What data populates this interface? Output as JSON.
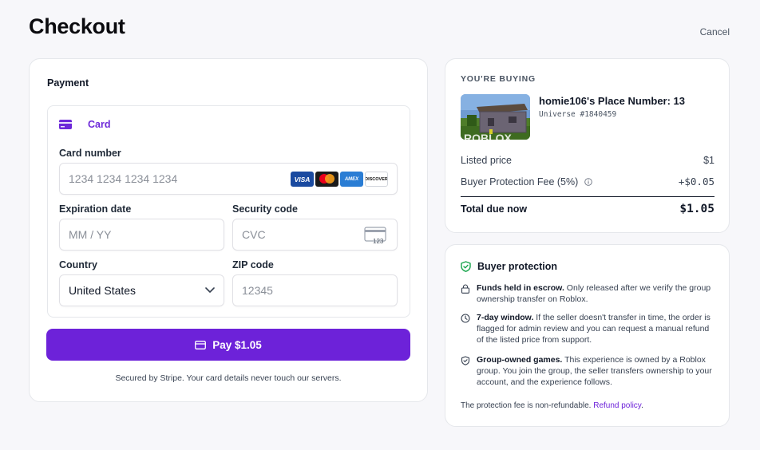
{
  "header": {
    "title": "Checkout",
    "cancel_label": "Cancel"
  },
  "payment": {
    "heading": "Payment",
    "method_tab": "Card",
    "card_number": {
      "label": "Card number",
      "placeholder": "1234 1234 1234 1234",
      "value": ""
    },
    "card_brands": [
      "VISA",
      "Mastercard",
      "AMEX",
      "DISCOVER"
    ],
    "expiration": {
      "label": "Expiration date",
      "placeholder": "MM / YY",
      "value": ""
    },
    "security_code": {
      "label": "Security code",
      "placeholder": "CVC",
      "value": "",
      "icon_text": "123"
    },
    "country": {
      "label": "Country",
      "value": "United States"
    },
    "zip": {
      "label": "ZIP code",
      "placeholder": "12345",
      "value": ""
    },
    "pay_button_label": "Pay $1.05",
    "secure_note": "Secured by Stripe. Your card details never touch our servers."
  },
  "summary": {
    "eyebrow": "YOU'RE BUYING",
    "product_name": "homie106's Place Number: 13",
    "universe": "Universe #1840459",
    "thumb_text": "ROBLOX",
    "rows": [
      {
        "label": "Listed price",
        "value": "$1"
      },
      {
        "label": "Buyer Protection Fee (5%)",
        "value": "+$0.05"
      }
    ],
    "total_label": "Total due now",
    "total_value": "$1.05"
  },
  "protection": {
    "heading": "Buyer protection",
    "items": [
      {
        "icon": "lock-icon",
        "title": "Funds held in escrow.",
        "text": " Only released after we verify the group ownership transfer on Roblox."
      },
      {
        "icon": "clock-icon",
        "title": "7-day window.",
        "text": " If the seller doesn't transfer in time, the order is flagged for admin review and you can request a manual refund of the listed price from support."
      },
      {
        "icon": "shield-icon",
        "title": "Group-owned games.",
        "text": " This experience is owned by a Roblox group. You join the group, the seller transfers ownership to your account, and the experience follows."
      }
    ],
    "fee_note": "The protection fee is non-refundable.",
    "refund_link": "Refund policy",
    "fee_note_end": "."
  },
  "colors": {
    "accent": "#6d22d9",
    "background": "#f7f7fa",
    "shield": "#16a34a"
  }
}
